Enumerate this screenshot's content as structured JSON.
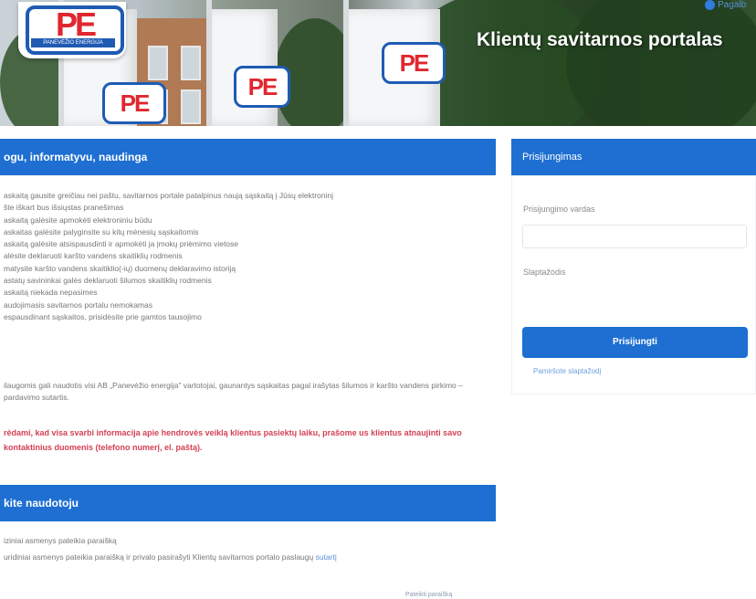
{
  "header": {
    "logo_text": "PE",
    "logo_sub": "PANEVĖŽIO ENERGIJA",
    "title": "Klientų savitarnos portalas",
    "help_label": "Pagalb"
  },
  "section1": {
    "heading": "ogu, informatyvu, naudinga",
    "items": [
      "askaitą gausite greičiau nei paštu, savitarnos portale patalpinus naują sąskaitą į Jūsų elektroninį",
      "šte iškart bus išsiųstas pranešimas",
      "askaitą galėsite apmokėti elektroniniu būdu",
      "askaitas galėsite palyginsite su kitų mėnesių sąskaitomis",
      "askaitą galėsite atsispausdinti ir apmokėti ja įmokų priėmimo vietose",
      "alėsite deklaruoti karšto vandens skaitiklių rodmenis",
      "matysite karšto vandens skaitiklio(-ių) duomenų deklaravimo istoriją",
      "astatų savininkai galės deklaruoti šilumos skaitiklių rodmenis",
      "askaitą niekada nepasimes",
      "audojimasis savitarnos portalu nemokamas",
      "espausdinant sąskaitos, prisidėsite prie gamtos tausojimo"
    ],
    "note": "ilaugomis gali naudotis visi AB „Panevėžio energija\" vartotojai, gaunantys sąskaitas pagal irašytas šilumos ir karšto vandens pirkimo – pardavimo sutartis.",
    "warning": "rėdami, kad visa svarbi informacija apie hendrovės veiklą klientus pasiektų laiku, prašome us klientus atnaujinti savo kontaktinius duomenis (telefono numerį, el. paštą)."
  },
  "section2": {
    "heading": "kite naudotoju",
    "line1": "iziniai asmenys pateikia paraišką",
    "line2_text": "uridiniai asmenys pateikia paraišką ir privalo pasirašyti Klientų savitarnos portalo paslaugų ",
    "line2_link": "sutartį",
    "footer_link": "Pateikti paraišką"
  },
  "login": {
    "heading": "Prisijungimas",
    "username_label": "Prisijungimo vardas",
    "username_value": "",
    "password_label": "Slaptažodis",
    "password_value": "",
    "submit_label": "Prisijungti",
    "forgot_label": "Pamiršote slaptažodį"
  },
  "colors": {
    "primary": "#1e6fd1",
    "warning": "#d44055",
    "logo_red": "#e0272f",
    "logo_blue": "#1f5bb3"
  }
}
